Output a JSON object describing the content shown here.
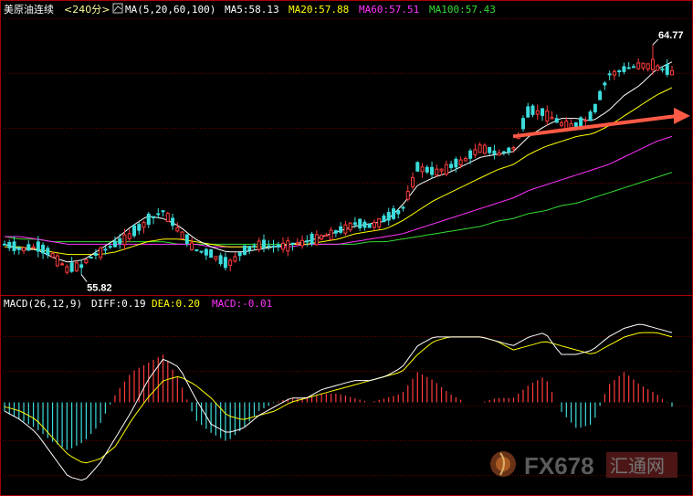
{
  "top_panel": {
    "symbol": "美原油连续",
    "period": "<240分>",
    "ma_params": "MA(5,20,60,100)",
    "ma5_label": "MA5:58.13",
    "ma20_label": "MA20:57.88",
    "ma60_label": "MA60:57.51",
    "ma100_label": "MA100:57.43"
  },
  "bottom_panel": {
    "macd_params": "MACD(26,12,9)",
    "diff_label": "DIFF:0.19",
    "dea_label": "DEA:0.20",
    "macd_label": "MACD:-0.01"
  },
  "watermark": {
    "text": "FX678",
    "cn": "汇通网"
  },
  "colors": {
    "up": "#ff3c3c",
    "down": "#3cdcdc",
    "ma5": "#ffffff",
    "ma20": "#ffff00",
    "ma60": "#ff33ff",
    "ma100": "#33dd33",
    "arrow": "#ff5a46",
    "grid": "#660000",
    "border": "#aa0000"
  },
  "chart_data": [
    {
      "type": "candlestick",
      "high_label": "64.77",
      "low_label": "55.82",
      "high": 64.77,
      "low": 55.82,
      "ylim": [
        55.2,
        65.8
      ],
      "ohlc_anchors": [
        [
          56.9,
          57.5,
          56.7,
          57.0
        ],
        [
          57.0,
          57.2,
          56.6,
          56.8
        ],
        [
          56.8,
          57.1,
          56.5,
          56.9
        ],
        [
          56.9,
          57.0,
          56.3,
          56.6
        ],
        [
          56.6,
          56.8,
          55.82,
          56.0
        ],
        [
          56.0,
          56.5,
          55.9,
          56.3
        ],
        [
          56.3,
          56.9,
          56.2,
          56.7
        ],
        [
          56.7,
          57.2,
          56.5,
          57.0
        ],
        [
          57.0,
          57.6,
          56.9,
          57.4
        ],
        [
          57.4,
          58.1,
          57.2,
          57.9
        ],
        [
          57.9,
          58.5,
          57.7,
          58.3
        ],
        [
          58.3,
          58.4,
          57.3,
          57.5
        ],
        [
          57.5,
          57.6,
          56.5,
          56.8
        ],
        [
          56.8,
          57.1,
          56.4,
          56.6
        ],
        [
          56.6,
          56.7,
          56.0,
          56.2
        ],
        [
          56.2,
          56.9,
          56.1,
          56.7
        ],
        [
          56.7,
          57.2,
          56.5,
          57.0
        ],
        [
          57.0,
          57.3,
          56.7,
          56.9
        ],
        [
          56.9,
          57.2,
          56.6,
          57.0
        ],
        [
          57.0,
          57.3,
          56.8,
          57.1
        ],
        [
          57.1,
          57.5,
          57.0,
          57.3
        ],
        [
          57.3,
          57.7,
          57.2,
          57.5
        ],
        [
          57.5,
          57.9,
          57.4,
          57.8
        ],
        [
          57.8,
          58.0,
          57.5,
          57.7
        ],
        [
          57.7,
          58.2,
          57.6,
          58.0
        ],
        [
          58.0,
          58.5,
          57.9,
          58.3
        ],
        [
          58.3,
          60.3,
          58.2,
          60.0
        ],
        [
          60.0,
          60.4,
          59.6,
          59.8
        ],
        [
          59.8,
          60.2,
          59.6,
          60.0
        ],
        [
          60.0,
          60.5,
          59.8,
          60.3
        ],
        [
          60.3,
          61.0,
          60.2,
          60.8
        ],
        [
          60.8,
          61.3,
          60.3,
          60.5
        ],
        [
          60.5,
          60.9,
          60.3,
          60.7
        ],
        [
          60.7,
          62.4,
          60.6,
          62.2
        ],
        [
          62.2,
          62.5,
          61.9,
          62.1
        ],
        [
          62.1,
          62.4,
          61.5,
          61.7
        ],
        [
          61.7,
          62.0,
          61.4,
          61.6
        ],
        [
          61.6,
          62.2,
          61.5,
          62.0
        ],
        [
          62.0,
          63.8,
          61.9,
          63.6
        ],
        [
          63.6,
          64.0,
          63.4,
          63.8
        ],
        [
          63.8,
          64.1,
          63.6,
          64.0
        ],
        [
          64.0,
          64.77,
          63.7,
          63.9
        ],
        [
          63.9,
          64.0,
          63.6,
          63.7
        ]
      ],
      "ma5": [
        57.0,
        56.8,
        56.8,
        56.5,
        56.3,
        56.4,
        56.8,
        57.2,
        57.7,
        58.1,
        58.0,
        57.7,
        57.2,
        56.9,
        56.7,
        56.7,
        56.8,
        56.9,
        57.0,
        57.1,
        57.3,
        57.5,
        57.7,
        57.8,
        57.9,
        58.5,
        59.3,
        59.6,
        59.8,
        60.1,
        60.4,
        60.5,
        60.6,
        61.2,
        61.6,
        61.9,
        61.9,
        61.8,
        62.2,
        62.8,
        63.2,
        63.8,
        64.1
      ],
      "ma20": [
        56.9,
        56.9,
        56.8,
        56.7,
        56.6,
        56.6,
        56.6,
        56.7,
        56.9,
        57.1,
        57.2,
        57.2,
        57.1,
        57.0,
        56.9,
        56.9,
        56.9,
        56.9,
        57.0,
        57.0,
        57.1,
        57.2,
        57.4,
        57.5,
        57.6,
        57.9,
        58.3,
        58.7,
        59.0,
        59.3,
        59.6,
        59.9,
        60.1,
        60.5,
        60.8,
        61.0,
        61.2,
        61.3,
        61.6,
        62.0,
        62.4,
        62.8,
        63.1
      ],
      "ma60": [
        57.3,
        57.3,
        57.2,
        57.1,
        57.0,
        57.0,
        57.0,
        57.0,
        57.0,
        57.0,
        57.0,
        57.0,
        57.0,
        56.9,
        56.9,
        56.9,
        56.9,
        56.9,
        56.9,
        57.0,
        57.0,
        57.0,
        57.1,
        57.2,
        57.3,
        57.4,
        57.6,
        57.8,
        58.0,
        58.2,
        58.4,
        58.6,
        58.8,
        59.1,
        59.3,
        59.5,
        59.7,
        59.9,
        60.1,
        60.4,
        60.7,
        61.0,
        61.2
      ],
      "ma100": [
        57.3,
        57.2,
        57.2,
        57.1,
        57.1,
        57.1,
        57.1,
        57.1,
        57.1,
        57.1,
        57.1,
        57.0,
        57.0,
        57.0,
        57.0,
        57.0,
        57.0,
        57.0,
        57.0,
        57.0,
        57.0,
        57.0,
        57.0,
        57.1,
        57.1,
        57.2,
        57.3,
        57.4,
        57.5,
        57.6,
        57.7,
        57.9,
        58.0,
        58.2,
        58.3,
        58.5,
        58.6,
        58.8,
        59.0,
        59.2,
        59.4,
        59.6,
        59.8
      ],
      "arrow": {
        "from": 61.2,
        "to": 62.0
      }
    },
    {
      "type": "macd",
      "ylim": [
        -1.0,
        1.0
      ],
      "diff": [
        -0.1,
        -0.2,
        -0.35,
        -0.6,
        -0.85,
        -0.9,
        -0.7,
        -0.4,
        -0.1,
        0.25,
        0.5,
        0.4,
        0.05,
        -0.25,
        -0.35,
        -0.3,
        -0.15,
        -0.05,
        0.05,
        0.05,
        0.15,
        0.2,
        0.25,
        0.25,
        0.3,
        0.4,
        0.65,
        0.75,
        0.75,
        0.75,
        0.75,
        0.7,
        0.65,
        0.75,
        0.8,
        0.55,
        0.55,
        0.6,
        0.75,
        0.85,
        0.9,
        0.85,
        0.8
      ],
      "dea": [
        -0.05,
        -0.1,
        -0.2,
        -0.4,
        -0.6,
        -0.7,
        -0.65,
        -0.5,
        -0.2,
        0.05,
        0.25,
        0.3,
        0.2,
        0.05,
        -0.15,
        -0.2,
        -0.15,
        -0.1,
        0.0,
        0.05,
        0.1,
        0.15,
        0.2,
        0.25,
        0.3,
        0.35,
        0.55,
        0.7,
        0.75,
        0.75,
        0.75,
        0.7,
        0.6,
        0.65,
        0.7,
        0.65,
        0.6,
        0.55,
        0.65,
        0.75,
        0.8,
        0.8,
        0.75
      ],
      "hist": [
        -0.1,
        -0.2,
        -0.3,
        -0.45,
        -0.55,
        -0.45,
        -0.25,
        0.1,
        0.35,
        0.45,
        0.55,
        0.25,
        -0.2,
        -0.35,
        -0.45,
        -0.3,
        -0.1,
        0.0,
        0.05,
        0.05,
        0.1,
        0.1,
        0.05,
        0.0,
        0.05,
        0.1,
        0.35,
        0.25,
        0.1,
        0.0,
        0.0,
        0.05,
        0.05,
        0.2,
        0.3,
        -0.1,
        -0.3,
        -0.25,
        0.2,
        0.35,
        0.2,
        0.1,
        -0.05
      ]
    }
  ]
}
